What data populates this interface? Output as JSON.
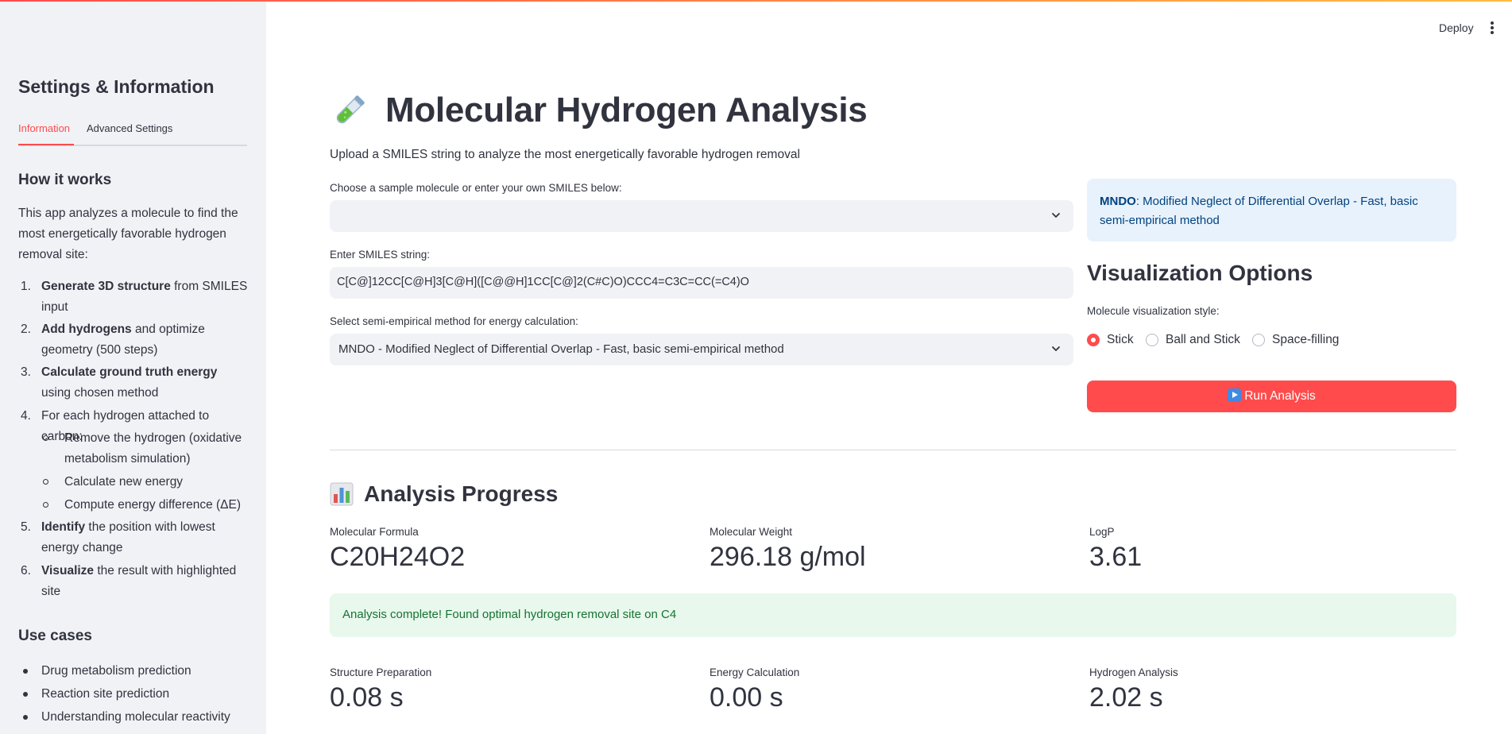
{
  "header": {
    "deploy_label": "Deploy"
  },
  "sidebar": {
    "title": "Settings & Information",
    "tabs": [
      {
        "label": "Information",
        "active": true
      },
      {
        "label": "Advanced Settings",
        "active": false
      }
    ],
    "how_it_works": {
      "heading": "How it works",
      "intro": "This app analyzes a molecule to find the most energetically favorable hydrogen removal site:",
      "steps": [
        {
          "num": "1.",
          "bold": "Generate 3D structure",
          "rest": " from SMILES input"
        },
        {
          "num": "2.",
          "bold": "Add hydrogens",
          "rest": " and optimize geometry (500 steps)"
        },
        {
          "num": "3.",
          "bold": "Calculate ground truth energy",
          "rest": " using chosen method"
        },
        {
          "num": "4.",
          "bold": "",
          "rest": "For each hydrogen attached to carbon:"
        },
        {
          "num": "5.",
          "bold": "Identify",
          "rest": " the position with lowest energy change"
        },
        {
          "num": "6.",
          "bold": "Visualize",
          "rest": " the result with highlighted site"
        }
      ],
      "substeps": [
        "Remove the hydrogen (oxidative metabolism simulation)",
        "Calculate new energy",
        "Compute energy difference (ΔE)"
      ]
    },
    "use_cases": {
      "heading": "Use cases",
      "items": [
        "Drug metabolism prediction",
        "Reaction site prediction",
        "Understanding molecular reactivity"
      ]
    }
  },
  "main": {
    "title_icon": "test-tube-icon",
    "title": "Molecular Hydrogen Analysis",
    "subtitle": "Upload a SMILES string to analyze the most energetically favorable hydrogen removal",
    "sample_select": {
      "label": "Choose a sample molecule or enter your own SMILES below:",
      "value": ""
    },
    "smiles_input": {
      "label": "Enter SMILES string:",
      "value": "C[C@]12CC[C@H]3[C@H]([C@@H]1CC[C@]2(C#C)O)CCC4=C3C=CC(=C4)O"
    },
    "method_select": {
      "label": "Select semi-empirical method for energy calculation:",
      "value": "MNDO - Modified Neglect of Differential Overlap - Fast, basic semi-empirical method"
    },
    "info_box": {
      "bold": "MNDO",
      "text": ": Modified Neglect of Differential Overlap - Fast, basic semi-empirical method"
    },
    "visualization": {
      "heading": "Visualization Options",
      "label": "Molecule visualization style:",
      "options": [
        "Stick",
        "Ball and Stick",
        "Space-filling"
      ],
      "selected": "Stick"
    },
    "run_button": {
      "icon": "play-button-icon",
      "label": "Run Analysis"
    },
    "progress": {
      "icon": "bar-chart-icon",
      "heading": "Analysis Progress",
      "metrics": [
        {
          "label": "Molecular Formula",
          "value": "C20H24O2"
        },
        {
          "label": "Molecular Weight",
          "value": "296.18 g/mol"
        },
        {
          "label": "LogP",
          "value": "3.61"
        }
      ],
      "success_message": "Analysis complete! Found optimal hydrogen removal site on C4",
      "timings": [
        {
          "label": "Structure Preparation",
          "value": "0.08 s"
        },
        {
          "label": "Energy Calculation",
          "value": "0.00 s"
        },
        {
          "label": "Hydrogen Analysis",
          "value": "2.02 s"
        }
      ]
    }
  },
  "colors": {
    "accent": "#ff4b4b",
    "sidebar_bg": "#f0f2f6",
    "info_bg": "#e8f2fc",
    "info_text": "#004280",
    "success_bg": "#e8f8ec",
    "success_text": "#177233"
  }
}
